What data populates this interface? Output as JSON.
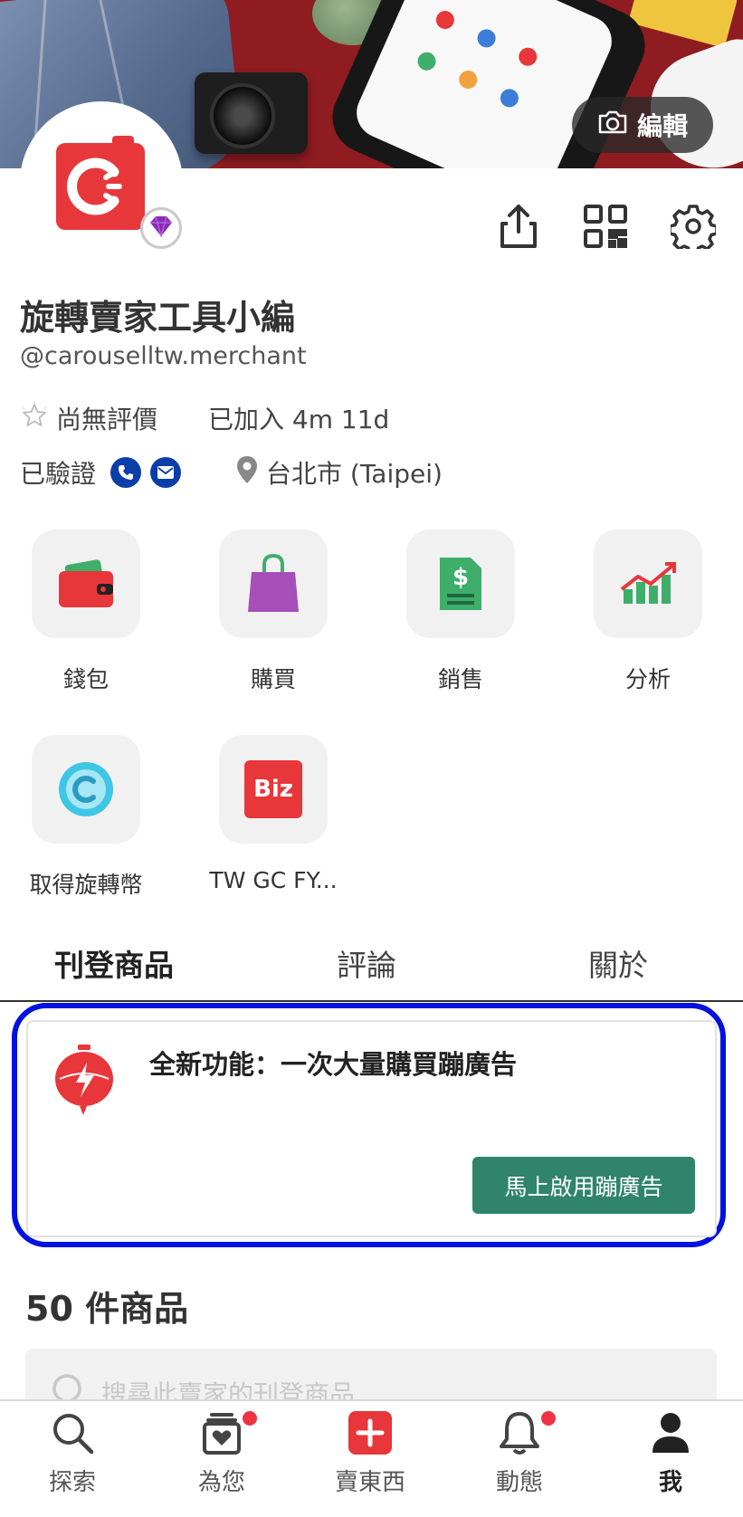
{
  "header": {
    "edit_label": "編輯"
  },
  "profile": {
    "name": "旋轉賣家工具小編",
    "handle": "@carouselltw.merchant",
    "rating_text": "尚無評價",
    "joined_text": "已加入 4m 11d",
    "verified_label": "已驗證",
    "location": "台北市 (Taipei)"
  },
  "shortcuts": [
    {
      "label": "錢包",
      "icon": "wallet-icon"
    },
    {
      "label": "購買",
      "icon": "shopping-bag-icon"
    },
    {
      "label": "銷售",
      "icon": "invoice-icon"
    },
    {
      "label": "分析",
      "icon": "chart-icon"
    },
    {
      "label": "取得旋轉幣",
      "icon": "coin-icon"
    },
    {
      "label": "TW GC FY...",
      "icon": "biz-icon",
      "badge_text": "Biz"
    }
  ],
  "tabs": [
    {
      "label": "刊登商品",
      "active": true
    },
    {
      "label": "評論",
      "active": false
    },
    {
      "label": "關於",
      "active": false
    }
  ],
  "promo": {
    "title": "全新功能：一次大量購買蹦廣告",
    "button_label": "馬上啟用蹦廣告"
  },
  "listings": {
    "count_text": "50 件商品",
    "search_placeholder": "搜尋此賣家的刊登商品"
  },
  "bottom_nav": [
    {
      "label": "探索",
      "icon": "search-icon",
      "dot": false
    },
    {
      "label": "為您",
      "icon": "for-you-icon",
      "dot": true
    },
    {
      "label": "賣東西",
      "icon": "sell-plus-icon",
      "dot": false
    },
    {
      "label": "動態",
      "icon": "bell-icon",
      "dot": true
    },
    {
      "label": "我",
      "icon": "profile-icon",
      "dot": false,
      "active": true
    }
  ],
  "colors": {
    "brand_red": "#e8373b",
    "promo_button": "#2f8469",
    "highlight_border": "#0011e0",
    "verified_blue": "#0b3ea8",
    "notification_dot": "#ee3344"
  }
}
